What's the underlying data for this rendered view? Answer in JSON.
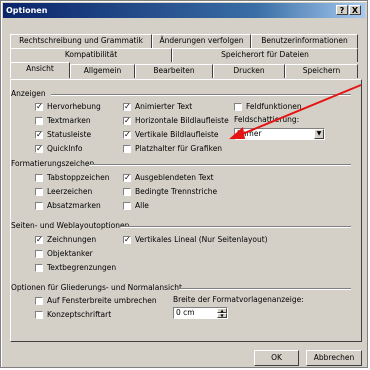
{
  "window": {
    "title": "Optionen",
    "help_label": "?",
    "close_label": "X"
  },
  "tabs_row1": [
    "Rechtschreibung und Grammatik",
    "Änderungen verfolgen",
    "Benutzerinformationen"
  ],
  "tabs_row2": [
    "Kompatibilität",
    "Speicherort für Dateien"
  ],
  "tabs_row3": [
    "Ansicht",
    "Allgemein",
    "Bearbeiten",
    "Drucken",
    "Speichern"
  ],
  "active_tab": "Ansicht",
  "groups": {
    "anzeigen": "Anzeigen",
    "formatierung": "Formatierungszeichen",
    "seiten": "Seiten- und Weblayoutoptionen",
    "gliederung": "Optionen für Gliederungs- und Normalansicht"
  },
  "checks": {
    "hervorhebung": {
      "label": "Hervorhebung",
      "checked": true
    },
    "animierter_text": {
      "label": "Animierter Text",
      "checked": true
    },
    "feldfunktionen": {
      "label": "Feldfunktionen",
      "checked": false
    },
    "textmarken": {
      "label": "Textmarken",
      "checked": false
    },
    "horiz_bildlauf": {
      "label": "Horizontale Bildlaufleiste",
      "checked": true
    },
    "statusleiste": {
      "label": "Statusleiste",
      "checked": true
    },
    "vert_bildlauf": {
      "label": "Vertikale Bildlaufleiste",
      "checked": true
    },
    "quickinfo": {
      "label": "QuickInfo",
      "checked": true
    },
    "platzhalter": {
      "label": "Platzhalter für Grafiken",
      "checked": false
    },
    "tabstoppzeichen": {
      "label": "Tabstoppzeichen",
      "checked": false
    },
    "ausgeblendeter": {
      "label": "Ausgeblendeten Text",
      "checked": true
    },
    "leerzeichen": {
      "label": "Leerzeichen",
      "checked": false
    },
    "bedingte": {
      "label": "Bedingte Trennstriche",
      "checked": false
    },
    "absatzmarken": {
      "label": "Absatzmarken",
      "checked": false
    },
    "alle": {
      "label": "Alle",
      "checked": false
    },
    "zeichnungen": {
      "label": "Zeichnungen",
      "checked": true
    },
    "vert_lineal": {
      "label": "Vertikales Lineal (Nur Seitenlayout)",
      "checked": true
    },
    "objektanker": {
      "label": "Objektanker",
      "checked": false
    },
    "textbegrenzungen": {
      "label": "Textbegrenzungen",
      "checked": false
    },
    "fensterbreite": {
      "label": "Auf Fensterbreite umbrechen",
      "checked": false
    },
    "konzeptschrift": {
      "label": "Konzeptschriftart",
      "checked": false
    }
  },
  "feldschattierung": {
    "label": "Feldschattierung:",
    "value": "Immer"
  },
  "formatvorlagen": {
    "label": "Breite der Formatvorlagenanzeige:",
    "value": "0 cm"
  },
  "buttons": {
    "ok": "OK",
    "cancel": "Abbrechen"
  },
  "colors": {
    "title_start": "#0a246a",
    "title_end": "#a6caf0",
    "arrow": "#e41414",
    "face": "#d4d0c8"
  }
}
